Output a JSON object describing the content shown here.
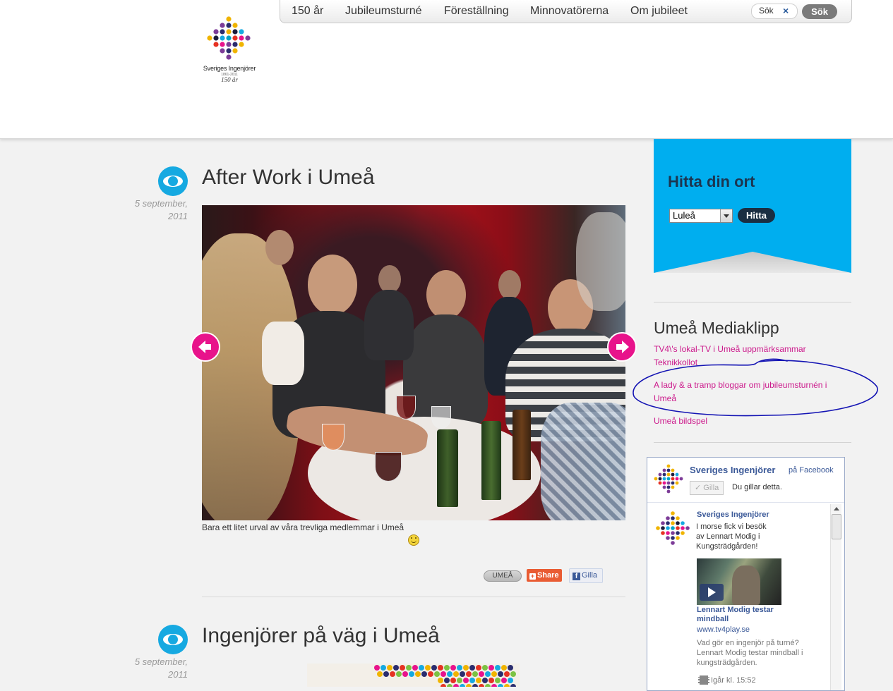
{
  "logo": {
    "brand": "Sveriges Ingenjörer",
    "years": "1861-2011",
    "anniversary": "150 år"
  },
  "nav": {
    "items": [
      "150 år",
      "Jubileumsturné",
      "Föreställning",
      "Minnovatörerna",
      "Om jubileet"
    ]
  },
  "search": {
    "value": "Sök",
    "clear_icon": "×",
    "button": "Sök"
  },
  "posts": [
    {
      "title": "After Work i Umeå",
      "date_line1": "5 september,",
      "date_line2": "2011",
      "caption": "Bara ett litet urval av våra trevliga medlemmar i Umeå",
      "tag": "UMEÅ",
      "share": "Share",
      "like": "Gilla"
    },
    {
      "title": "Ingenjörer på väg i Umeå",
      "date_line1": "5 september,",
      "date_line2": "2011"
    }
  ],
  "sidebar": {
    "find": {
      "title": "Hitta din ort",
      "selected_city": "Luleå",
      "button": "Hitta",
      "color": "#00aeef"
    },
    "media": {
      "title": "Umeå Mediaklipp",
      "links": [
        "TV4\\'s lokal-TV i Umeå uppmärksammar Teknikkollot",
        "A lady & a tramp bloggar om jubileumsturnén i Umeå",
        "Umeå bildspel"
      ]
    },
    "facebook": {
      "page_name": "Sveriges Ingenjörer",
      "on_facebook": "på Facebook",
      "like_button": "Gilla",
      "you_like": "Du gillar detta.",
      "post": {
        "author": "Sveriges Ingenjörer",
        "text": "I morse fick vi besök av Lennart Modig i Kungsträdgården!",
        "link_title": "Lennart Modig testar mindball",
        "link_source": "www.tv4play.se",
        "link_desc": "Vad gör en ingenjör på turné? Lennart Modig testar mindball i kungsträdgården.",
        "time": "Igår kl. 15:52"
      }
    }
  },
  "colors": {
    "accent_pink": "#e8138b",
    "eye_blue": "#16a9e1",
    "link_pink": "#cc1a8c",
    "annotation_blue": "#1414b4"
  }
}
